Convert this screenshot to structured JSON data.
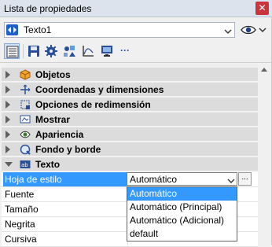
{
  "window": {
    "title": "Lista de propiedades",
    "close_glyph": "✕"
  },
  "object_selector": {
    "value": "Texto1"
  },
  "toolbar": {
    "buttons": [
      {
        "icon": "properties-list-icon",
        "selected": true
      },
      {
        "icon": "save-icon"
      },
      {
        "icon": "gear-icon"
      },
      {
        "icon": "shapes-icon"
      },
      {
        "icon": "chart-axis-icon"
      },
      {
        "icon": "monitor-icon"
      },
      {
        "icon": "more-icon",
        "glyph": "···"
      }
    ]
  },
  "categories": [
    {
      "label": "Objetos",
      "icon": "cube-icon",
      "expanded": false
    },
    {
      "label": "Coordenadas y dimensiones",
      "icon": "coordinates-icon",
      "expanded": false
    },
    {
      "label": "Opciones de redimensión",
      "icon": "resize-icon",
      "expanded": false
    },
    {
      "label": "Mostrar",
      "icon": "display-icon",
      "expanded": false
    },
    {
      "label": "Apariencia",
      "icon": "eye-icon",
      "expanded": false
    },
    {
      "label": "Fondo y borde",
      "icon": "paint-icon",
      "expanded": false
    },
    {
      "label": "Texto",
      "icon": "text-icon",
      "expanded": true
    }
  ],
  "properties": [
    {
      "name": "Hoja de estilo",
      "value": "Automático",
      "active": true
    },
    {
      "name": "Fuente",
      "value": ""
    },
    {
      "name": "Tamaño",
      "value": ""
    },
    {
      "name": "Negrita",
      "value": ""
    },
    {
      "name": "Cursiva",
      "value": ""
    }
  ],
  "ellipsis_label": "...",
  "dropdown_options": [
    "Automático",
    "Automático (Principal)",
    "Automático (Adicional)",
    "default"
  ],
  "colors": {
    "selection": "#3399ff",
    "close": "#c9353a",
    "category_bg": "#dcdcdc"
  }
}
